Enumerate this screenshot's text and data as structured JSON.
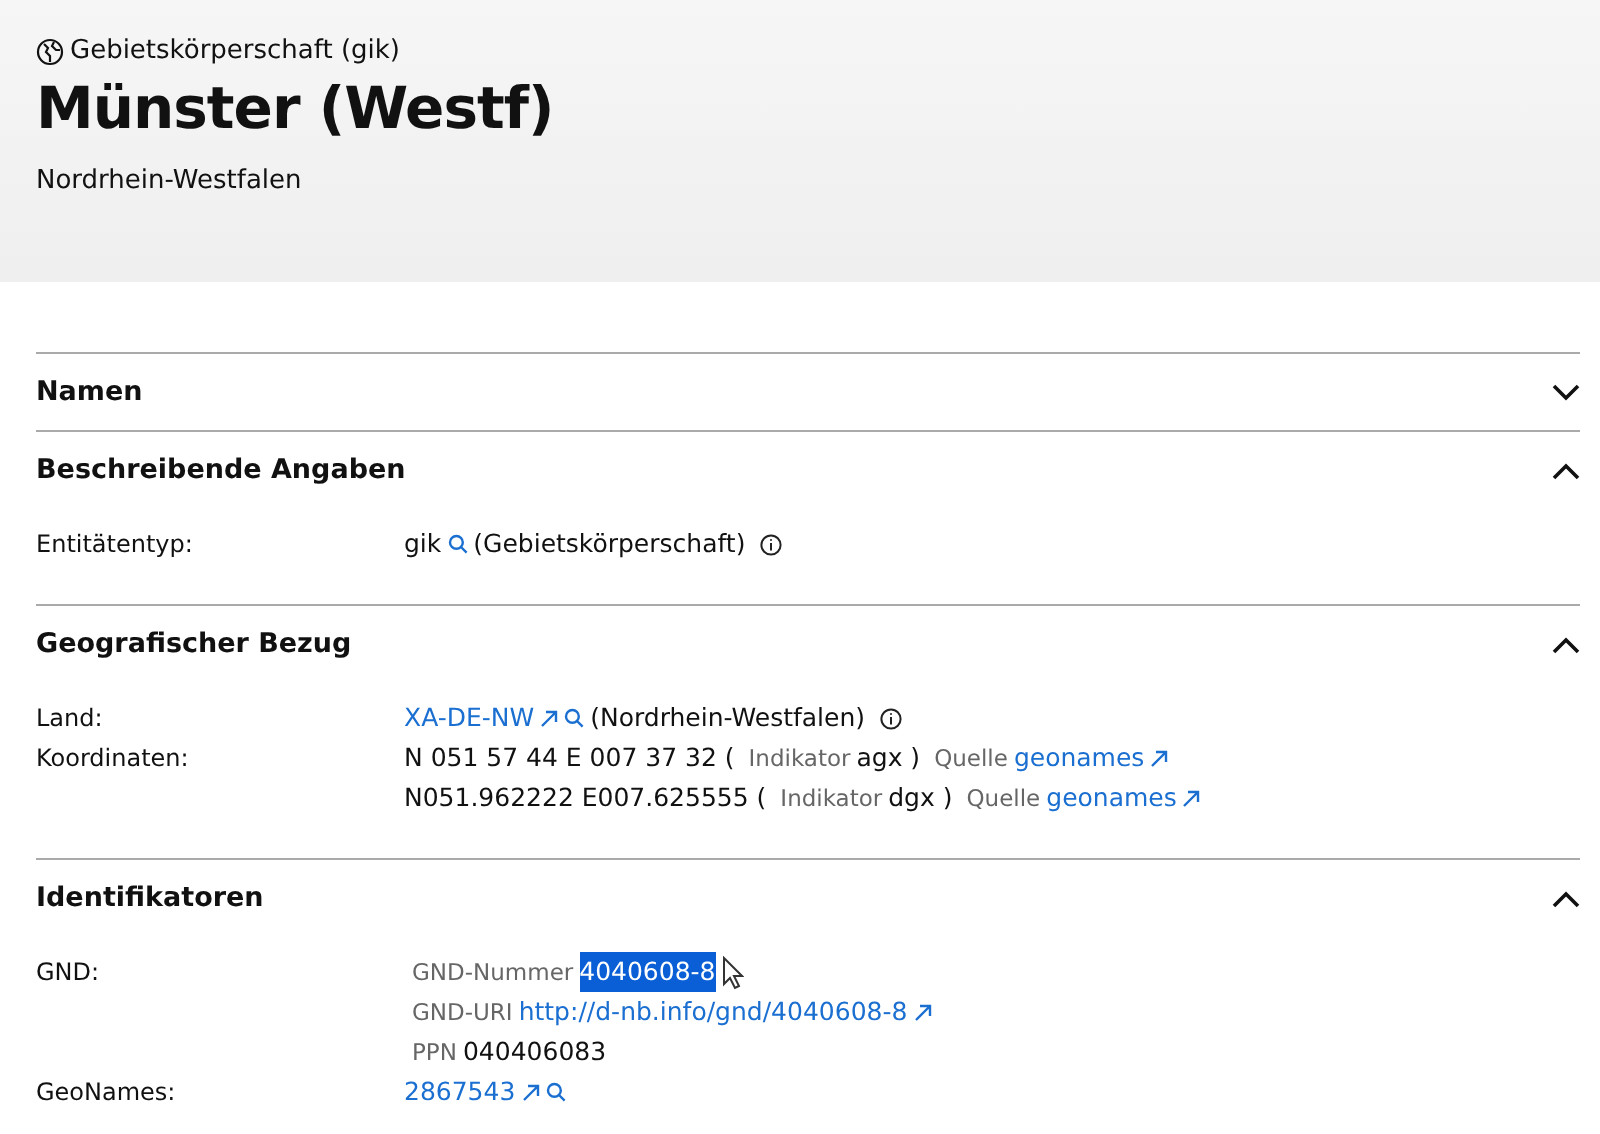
{
  "header": {
    "type_label": "Gebietskörperschaft (gik)",
    "title": "Münster (Westf)",
    "subtitle": "Nordrhein-Westfalen"
  },
  "sections": [
    {
      "title": "Namen",
      "expanded": false
    },
    {
      "title": "Beschreibende Angaben",
      "expanded": true,
      "rows": [
        {
          "label": "Entitätentyp:",
          "lines": [
            [
              {
                "kind": "text",
                "text": "gik"
              },
              {
                "kind": "search"
              },
              {
                "kind": "text",
                "text": "(Gebietskörperschaft)"
              },
              {
                "kind": "info"
              }
            ]
          ]
        }
      ]
    },
    {
      "title": "Geografischer Bezug",
      "expanded": true,
      "rows": [
        {
          "label": "Land:",
          "lines": [
            [
              {
                "kind": "link",
                "text": "XA-DE-NW"
              },
              {
                "kind": "external"
              },
              {
                "kind": "search"
              },
              {
                "kind": "text",
                "text": "(Nordrhein-Westfalen)"
              },
              {
                "kind": "info"
              }
            ]
          ]
        },
        {
          "label": "Koordinaten:",
          "lines": [
            [
              {
                "kind": "text",
                "text": "N 051 57 44 E 007 37 32 ("
              },
              {
                "kind": "muted",
                "text": "Indikator"
              },
              {
                "kind": "text",
                "text": "agx )"
              },
              {
                "kind": "muted",
                "text": "Quelle"
              },
              {
                "kind": "link",
                "text": "geonames"
              },
              {
                "kind": "external"
              }
            ],
            [
              {
                "kind": "text",
                "text": "N051.962222 E007.625555 ("
              },
              {
                "kind": "muted",
                "text": "Indikator"
              },
              {
                "kind": "text",
                "text": "dgx )"
              },
              {
                "kind": "muted",
                "text": "Quelle"
              },
              {
                "kind": "link",
                "text": "geonames"
              },
              {
                "kind": "external"
              }
            ]
          ]
        }
      ]
    },
    {
      "title": "Identifikatoren",
      "expanded": true,
      "rows": [
        {
          "label": "GND:",
          "lines": [
            [
              {
                "kind": "muted",
                "text": "GND-Nummer"
              },
              {
                "kind": "selected",
                "text": "4040608-8"
              },
              {
                "kind": "cursor"
              }
            ],
            [
              {
                "kind": "muted",
                "text": "GND-URI"
              },
              {
                "kind": "link",
                "text": "http://d-nb.info/gnd/4040608-8"
              },
              {
                "kind": "external"
              }
            ],
            [
              {
                "kind": "muted",
                "text": "PPN"
              },
              {
                "kind": "text",
                "text": "040406083"
              }
            ]
          ]
        },
        {
          "label": "GeoNames:",
          "lines": [
            [
              {
                "kind": "link",
                "text": "2867543"
              },
              {
                "kind": "external"
              },
              {
                "kind": "search"
              }
            ]
          ]
        }
      ]
    }
  ]
}
